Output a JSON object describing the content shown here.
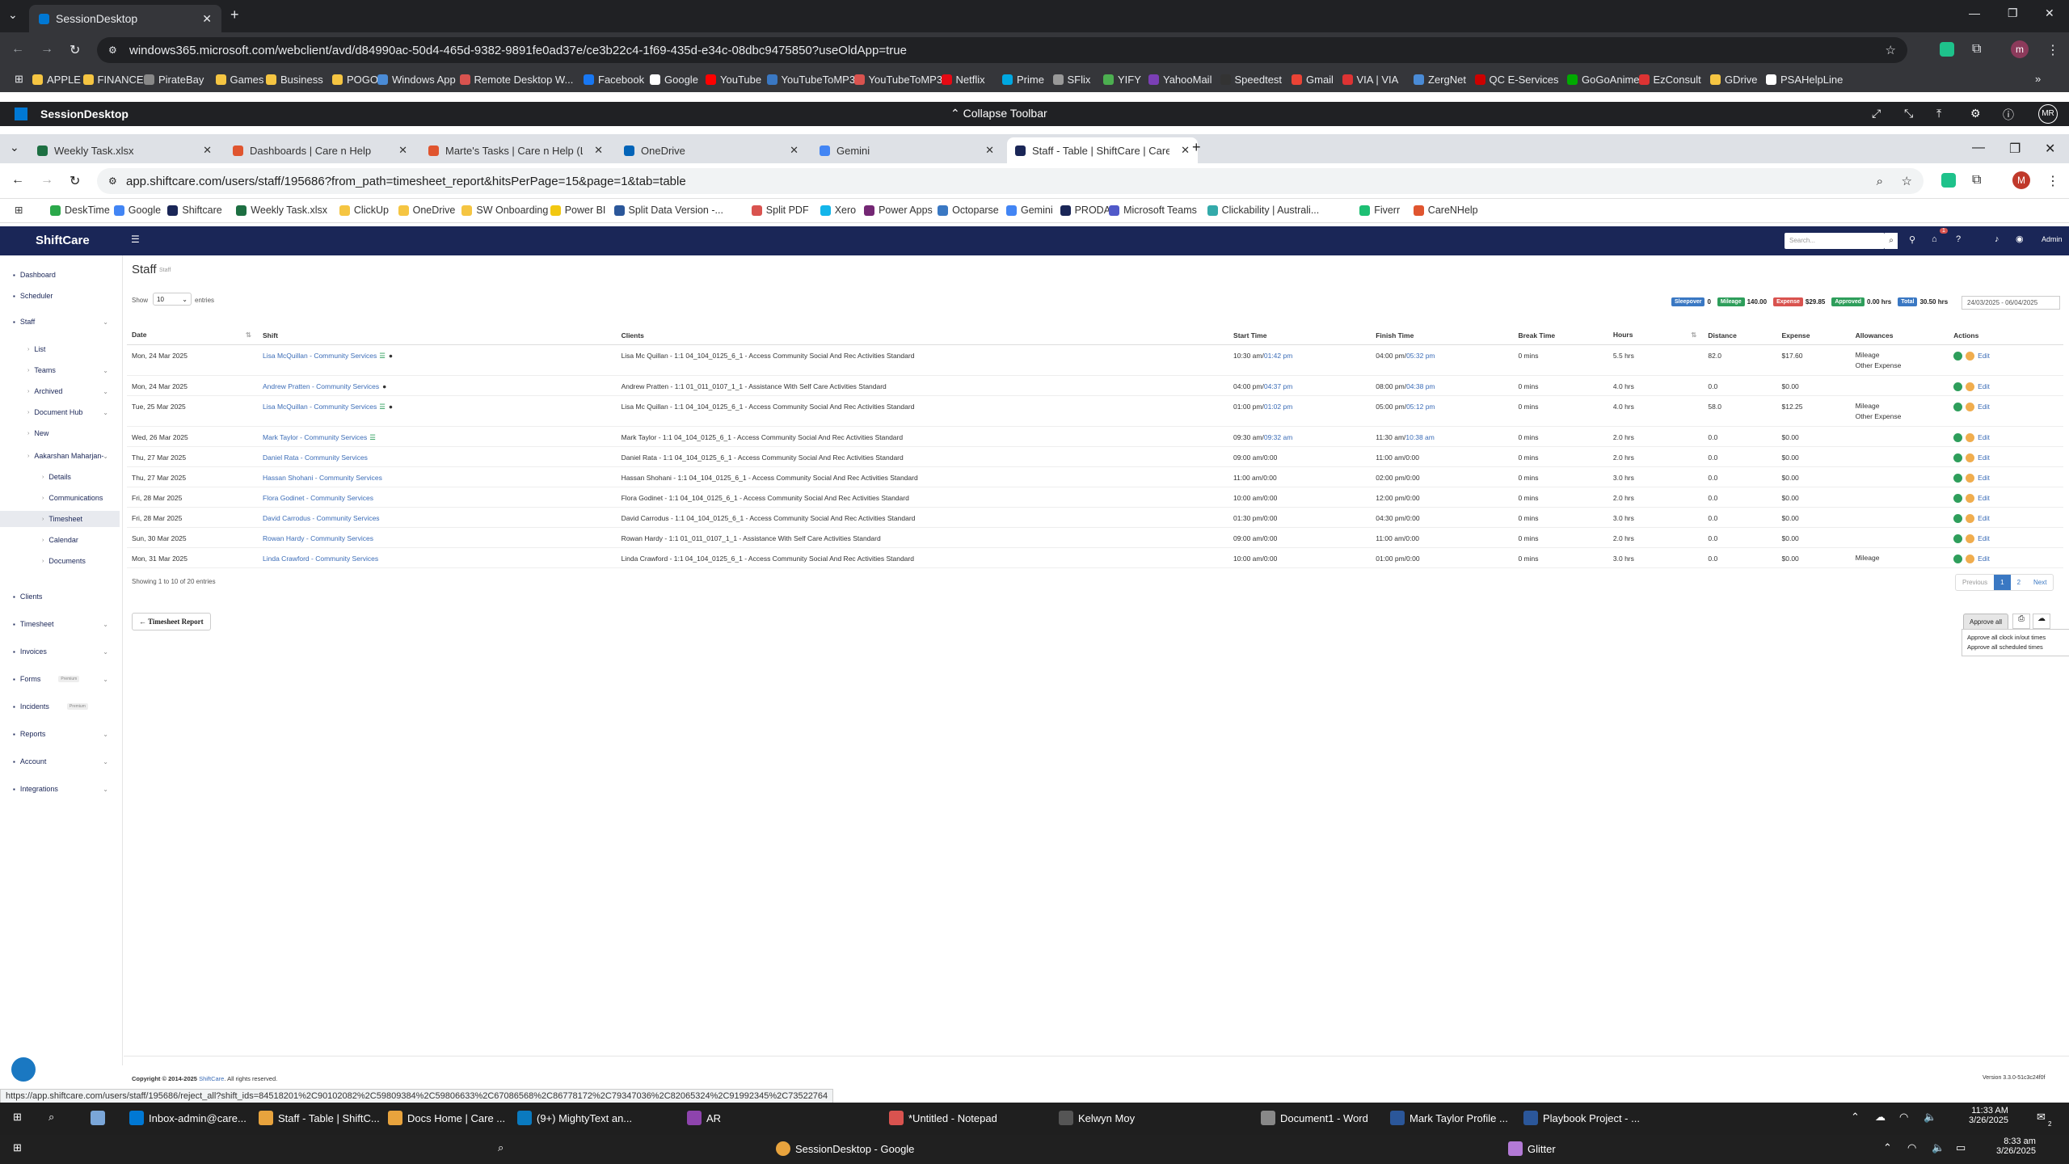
{
  "outer_browser": {
    "tab_title": "SessionDesktop",
    "url": "windows365.microsoft.com/webclient/avd/d84990ac-50d4-465d-9382-9891fe0ad37e/ce3b22c4-1f69-435d-e34c-08dbc9475850?useOldApp=true",
    "profile_letter": "m",
    "bookmarks": [
      "APPLE",
      "FINANCE",
      "PirateBay",
      "Games",
      "Business",
      "POGO",
      "Windows App",
      "Remote Desktop W...",
      "Facebook",
      "Google",
      "YouTube",
      "YouTubeToMP3",
      "YouTubeToMP3",
      "Netflix",
      "Prime",
      "SFlix",
      "YIFY",
      "YahooMail",
      "Speedtest",
      "Gmail",
      "VIA | VIA",
      "ZergNet",
      "QC E-Services",
      "GoGoAnime",
      "EzConsult",
      "GDrive",
      "PSAHelpLine"
    ]
  },
  "session_bar": {
    "title": "SessionDesktop",
    "collapse_label": "Collapse Toolbar",
    "avatar": "MR"
  },
  "inner_browser": {
    "tabs": [
      "Weekly Task.xlsx",
      "Dashboards | Care n Help",
      "Marte's Tasks | Care n Help (List)",
      "OneDrive",
      "Gemini",
      "Staff - Table | ShiftCare | Care n"
    ],
    "url": "app.shiftcare.com/users/staff/195686?from_path=timesheet_report&hitsPerPage=15&page=1&tab=table",
    "profile_letter": "M",
    "bookmarks": [
      "DeskTime",
      "Google",
      "Shiftcare",
      "Weekly Task.xlsx",
      "ClickUp",
      "OneDrive",
      "SW Onboarding",
      "Power BI",
      "Split Data Version -...",
      "Split PDF",
      "Xero",
      "Power Apps",
      "Octoparse",
      "Gemini",
      "PRODA",
      "Microsoft Teams",
      "Clickability | Australi...",
      "Fiverr",
      "CareNHelp"
    ]
  },
  "app": {
    "logo": "ShiftCare",
    "search_placeholder": "Search...",
    "admin_label": "Admin",
    "notif_count": "1",
    "sidebar": [
      {
        "label": "Dashboard",
        "icon": "dashboard-icon"
      },
      {
        "label": "Scheduler",
        "icon": "calendar-icon"
      },
      {
        "label": "Staff",
        "icon": "user-icon"
      },
      {
        "label": "List"
      },
      {
        "label": "Teams"
      },
      {
        "label": "Archived"
      },
      {
        "label": "Document Hub"
      },
      {
        "label": "New"
      },
      {
        "label": "Aakarshan Maharjan-"
      },
      {
        "label": "Details"
      },
      {
        "label": "Communications"
      },
      {
        "label": "Timesheet"
      },
      {
        "label": "Calendar"
      },
      {
        "label": "Documents"
      },
      {
        "label": "Clients",
        "icon": "clients-icon"
      },
      {
        "label": "Timesheet",
        "icon": "timesheet-icon"
      },
      {
        "label": "Invoices",
        "icon": "invoice-icon"
      },
      {
        "label": "Forms",
        "icon": "forms-icon",
        "badge": "Premium"
      },
      {
        "label": "Incidents",
        "icon": "incident-icon",
        "badge": "Premium"
      },
      {
        "label": "Reports",
        "icon": "reports-icon"
      },
      {
        "label": "Account",
        "icon": "account-icon"
      },
      {
        "label": "Integrations",
        "icon": "integrations-icon"
      }
    ],
    "page_title": "Staff",
    "page_subtitle": "Staff",
    "show_label": "Show",
    "entries_value": "10",
    "entries_label": "entries",
    "badges": [
      {
        "label": "Sleepover",
        "value": "0",
        "color": "#3a78c3"
      },
      {
        "label": "Mileage",
        "value": "140.00",
        "color": "#2e9e5b"
      },
      {
        "label": "Expense",
        "value": "$29.85",
        "color": "#d9534f"
      },
      {
        "label": "Approved",
        "value": "0.00 hrs",
        "color": "#2e9e5b"
      },
      {
        "label": "Total",
        "value": "30.50 hrs",
        "color": "#3a78c3"
      }
    ],
    "date_range": "24/03/2025 - 06/04/2025",
    "columns": [
      "Date",
      "Shift",
      "Clients",
      "Start Time",
      "Finish Time",
      "Break Time",
      "Hours",
      "Distance",
      "Expense",
      "Allowances",
      "Actions"
    ],
    "rows": [
      {
        "date": "Mon, 24 Mar 2025",
        "shift": "Lisa McQuillan - Community Services",
        "clients": "Lisa Mc Quillan - 1:1 04_104_0125_6_1 - Access Community Social And Rec Activities Standard",
        "start": "10:30 am",
        "start2": "01:42 pm",
        "finish": "04:00 pm",
        "finish2": "05:32 pm",
        "brk": "0 mins",
        "hours": "5.5 hrs",
        "dist": "82.0",
        "exp": "$17.60",
        "allow": "Mileage",
        "allow2": "Other Expense"
      },
      {
        "date": "Mon, 24 Mar 2025",
        "shift": "Andrew Pratten - Community Services",
        "clients": "Andrew Pratten - 1:1 01_011_0107_1_1 - Assistance With Self Care Activities Standard",
        "start": "04:00 pm",
        "start2": "04:37 pm",
        "finish": "08:00 pm",
        "finish2": "04:38 pm",
        "brk": "0 mins",
        "hours": "4.0 hrs",
        "dist": "0.0",
        "exp": "$0.00",
        "allow": "",
        "allow2": ""
      },
      {
        "date": "Tue, 25 Mar 2025",
        "shift": "Lisa McQuillan - Community Services",
        "clients": "Lisa Mc Quillan - 1:1 04_104_0125_6_1 - Access Community Social And Rec Activities Standard",
        "start": "01:00 pm",
        "start2": "01:02 pm",
        "finish": "05:00 pm",
        "finish2": "05:12 pm",
        "brk": "0 mins",
        "hours": "4.0 hrs",
        "dist": "58.0",
        "exp": "$12.25",
        "allow": "Mileage",
        "allow2": "Other Expense"
      },
      {
        "date": "Wed, 26 Mar 2025",
        "shift": "Mark Taylor - Community Services",
        "clients": "Mark Taylor - 1:1 04_104_0125_6_1 - Access Community Social And Rec Activities Standard",
        "start": "09:30 am",
        "start2": "09:32 am",
        "finish": "11:30 am",
        "finish2": "10:38 am",
        "brk": "0 mins",
        "hours": "2.0 hrs",
        "dist": "0.0",
        "exp": "$0.00",
        "allow": "",
        "allow2": ""
      },
      {
        "date": "Thu, 27 Mar 2025",
        "shift": "Daniel Rata - Community Services",
        "clients": "Daniel Rata - 1:1 04_104_0125_6_1 - Access Community Social And Rec Activities Standard",
        "start": "09:00 am/0:00",
        "start2": "",
        "finish": "11:00 am/0:00",
        "finish2": "",
        "brk": "0 mins",
        "hours": "2.0 hrs",
        "dist": "0.0",
        "exp": "$0.00",
        "allow": "",
        "allow2": ""
      },
      {
        "date": "Thu, 27 Mar 2025",
        "shift": "Hassan Shohani - Community Services",
        "clients": "Hassan Shohani - 1:1 04_104_0125_6_1 - Access Community Social And Rec Activities Standard",
        "start": "11:00 am/0:00",
        "start2": "",
        "finish": "02:00 pm/0:00",
        "finish2": "",
        "brk": "0 mins",
        "hours": "3.0 hrs",
        "dist": "0.0",
        "exp": "$0.00",
        "allow": "",
        "allow2": ""
      },
      {
        "date": "Fri, 28 Mar 2025",
        "shift": "Flora Godinet - Community Services",
        "clients": "Flora Godinet - 1:1 04_104_0125_6_1 - Access Community Social And Rec Activities Standard",
        "start": "10:00 am/0:00",
        "start2": "",
        "finish": "12:00 pm/0:00",
        "finish2": "",
        "brk": "0 mins",
        "hours": "2.0 hrs",
        "dist": "0.0",
        "exp": "$0.00",
        "allow": "",
        "allow2": ""
      },
      {
        "date": "Fri, 28 Mar 2025",
        "shift": "David Carrodus - Community Services",
        "clients": "David Carrodus - 1:1 04_104_0125_6_1 - Access Community Social And Rec Activities Standard",
        "start": "01:30 pm/0:00",
        "start2": "",
        "finish": "04:30 pm/0:00",
        "finish2": "",
        "brk": "0 mins",
        "hours": "3.0 hrs",
        "dist": "0.0",
        "exp": "$0.00",
        "allow": "",
        "allow2": ""
      },
      {
        "date": "Sun, 30 Mar 2025",
        "shift": "Rowan Hardy - Community Services",
        "clients": "Rowan Hardy - 1:1 01_011_0107_1_1 - Assistance With Self Care Activities Standard",
        "start": "09:00 am/0:00",
        "start2": "",
        "finish": "11:00 am/0:00",
        "finish2": "",
        "brk": "0 mins",
        "hours": "2.0 hrs",
        "dist": "0.0",
        "exp": "$0.00",
        "allow": "",
        "allow2": ""
      },
      {
        "date": "Mon, 31 Mar 2025",
        "shift": "Linda Crawford - Community Services",
        "clients": "Linda Crawford - 1:1 04_104_0125_6_1 - Access Community Social And Rec Activities Standard",
        "start": "10:00 am/0:00",
        "start2": "",
        "finish": "01:00 pm/0:00",
        "finish2": "",
        "brk": "0 mins",
        "hours": "3.0 hrs",
        "dist": "0.0",
        "exp": "$0.00",
        "allow": "Mileage",
        "allow2": ""
      }
    ],
    "edit_label": "Edit",
    "showing_text": "Showing 1 to 10 of 20 entries",
    "pager": {
      "prev": "Previous",
      "p1": "1",
      "p2": "2",
      "next": "Next"
    },
    "timesheet_report_btn": "← Timesheet Report",
    "approve_all": "Approve all",
    "approve_menu": [
      "Approve all clock in/out times",
      "Approve all scheduled times"
    ],
    "footer_copyright": "Copyright © 2014-2025",
    "footer_brand": "ShiftCare",
    "footer_rights": ". All rights reserved.",
    "footer_version": "Version 3.3.0-51c3c24f0f"
  },
  "status_url": "https://app.shiftcare.com/users/staff/195686/reject_all?shift_ids=84518201%2C90102082%2C59809384%2C59806633%2C67086568%2C86778172%2C79347036%2C82065324%2C91992345%2C73522764",
  "taskbar_inner": {
    "apps": [
      "Inbox-admin@care...",
      "Staff - Table | ShiftC...",
      "Docs Home | Care ...",
      "(9+) MightyText an...",
      "AR",
      "*Untitled - Notepad",
      "Kelwyn Moy",
      "Document1 - Word",
      "Mark Taylor Profile ...",
      "Playbook Project - ..."
    ],
    "time": "11:33 AM",
    "date": "3/26/2025",
    "notif": "2"
  },
  "taskbar_outer": {
    "apps": [
      "SessionDesktop - Google",
      "Glitter"
    ],
    "time": "8:33 am",
    "date": "3/26/2025"
  }
}
